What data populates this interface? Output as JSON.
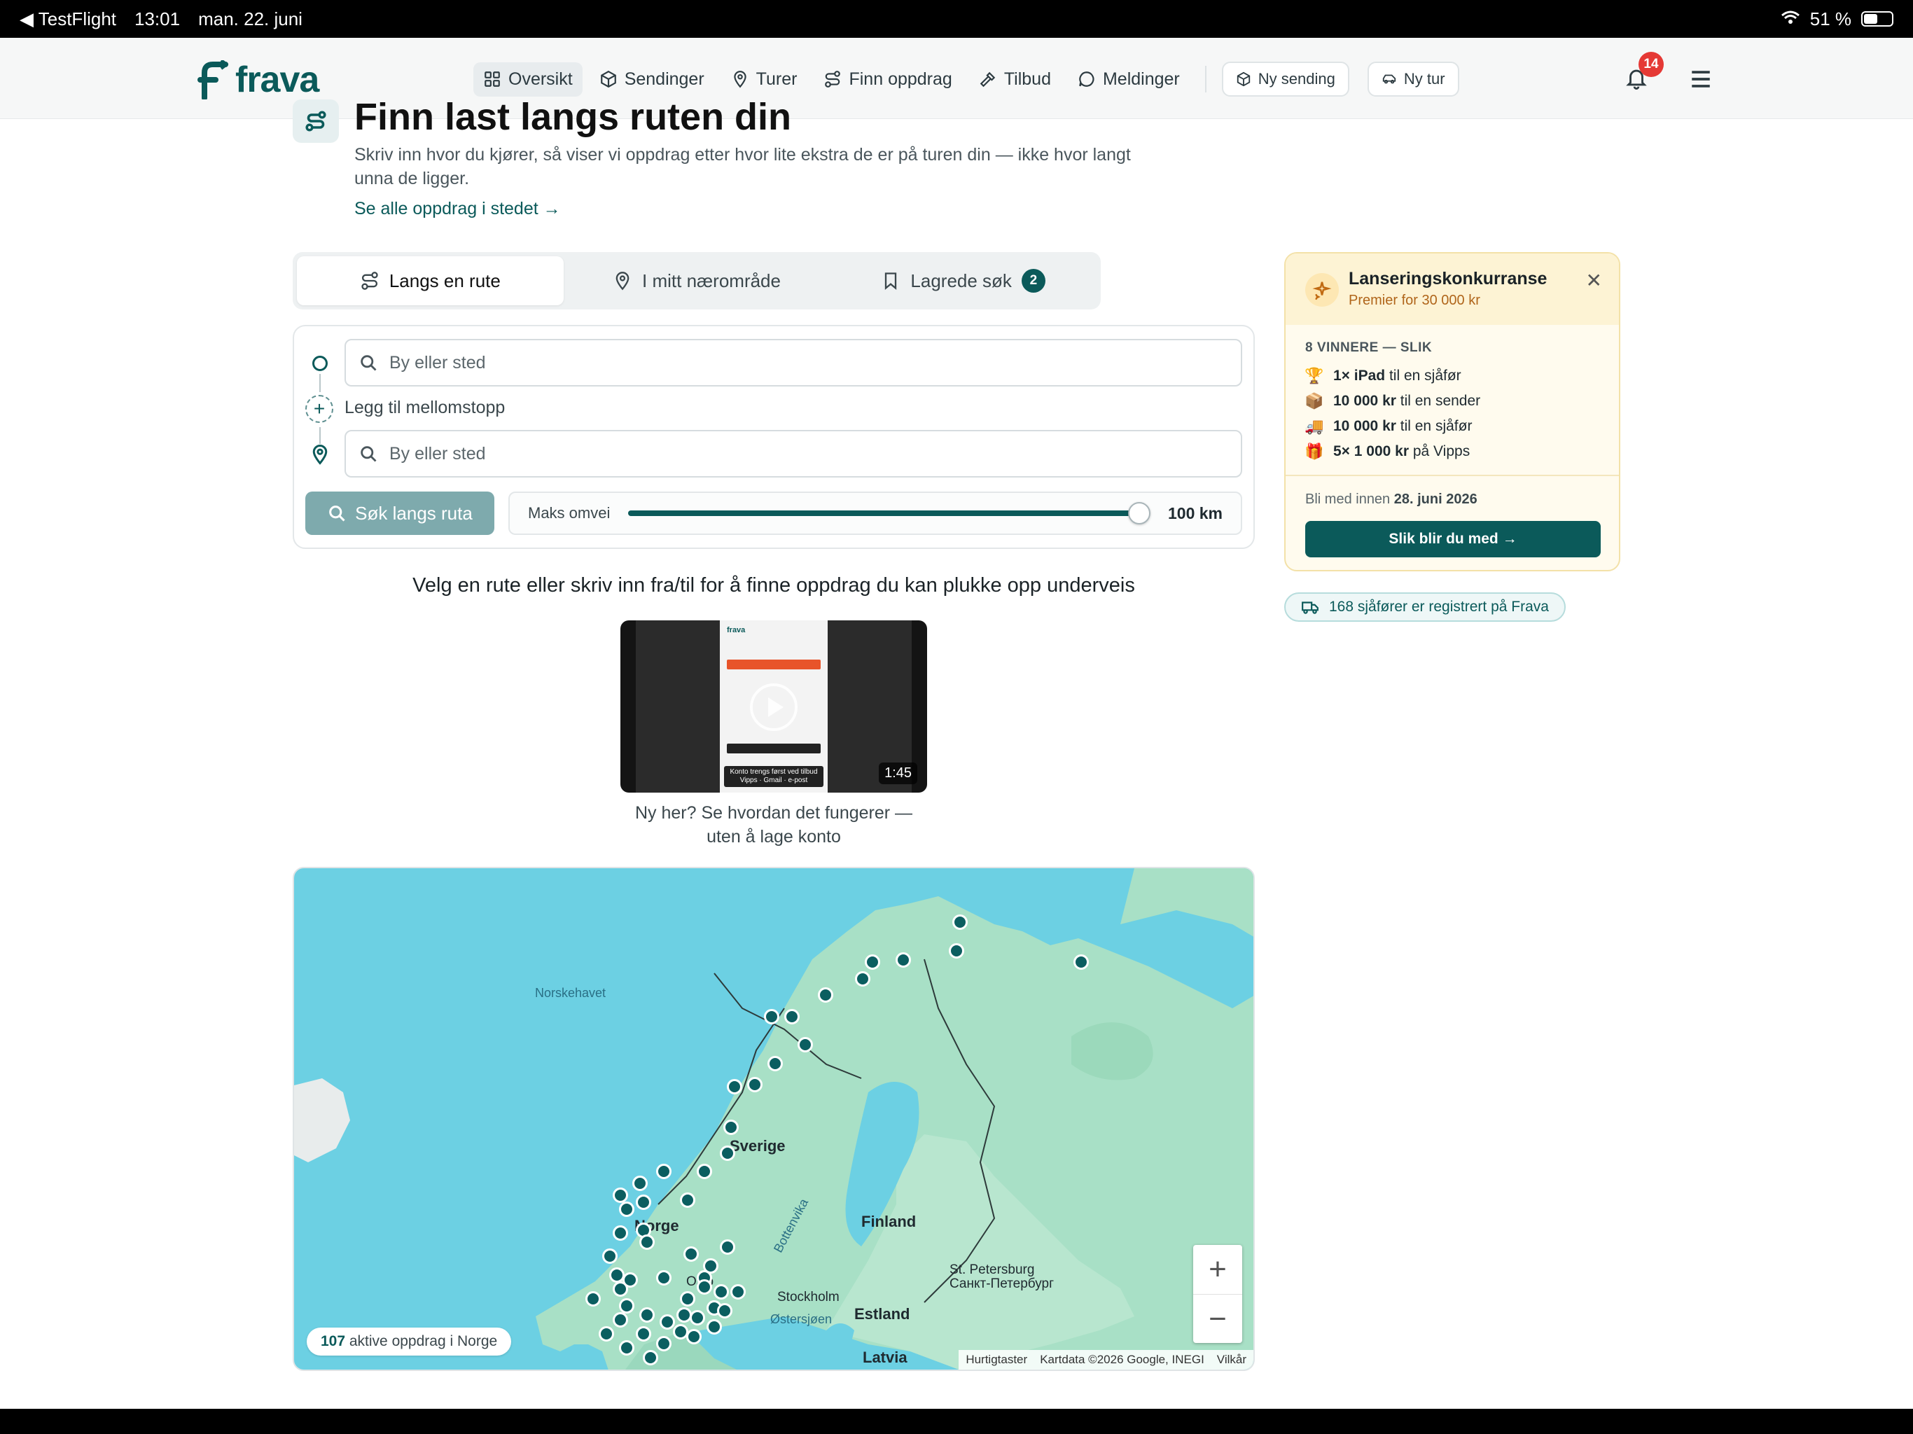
{
  "status_bar": {
    "back_app": "◀ TestFlight",
    "time": "13:01",
    "date": "man. 22. juni",
    "battery": "51 %",
    "battery_level": 0.51
  },
  "header": {
    "logo_text": "frava",
    "nav": [
      {
        "label": "Oversikt",
        "icon": "grid-icon",
        "active": true
      },
      {
        "label": "Sendinger",
        "icon": "box-icon"
      },
      {
        "label": "Turer",
        "icon": "pin-icon"
      },
      {
        "label": "Finn oppdrag",
        "icon": "route-icon"
      },
      {
        "label": "Tilbud",
        "icon": "hammer-icon"
      },
      {
        "label": "Meldinger",
        "icon": "chat-icon"
      }
    ],
    "new_shipment": "Ny sending",
    "new_trip": "Ny tur",
    "notifications_count": "14"
  },
  "intro": {
    "title": "Finn last langs ruten din",
    "description": "Skriv inn hvor du kjører, så viser vi oppdrag etter hvor lite ekstra de er på turen din — ikke hvor langt unna de ligger.",
    "link": "Se alle oppdrag i stedet →"
  },
  "tabs": [
    {
      "label": "Langs en rute",
      "active": true
    },
    {
      "label": "I mitt nærområde"
    },
    {
      "label": "Lagrede søk",
      "count": "2"
    }
  ],
  "search": {
    "from_placeholder": "By eller sted",
    "to_placeholder": "By eller sted",
    "add_stop": "Legg til mellomstopp",
    "button": "Søk langs ruta",
    "detour_label": "Maks omvei",
    "detour_value": "100 km",
    "detour_fraction": 1.0
  },
  "prompt": "Velg en rute eller skriv inn fra/til for å finne oppdrag du kan plukke opp underveis",
  "video": {
    "duration": "1:45",
    "inner_caption": "Konto trengs først ved tilbud Vipps · Gmail · e-post",
    "caption": "Ny her? Se hvordan det fungerer — uten å lage konto"
  },
  "map": {
    "labels": {
      "sea1": "Norskehavet",
      "sweden": "Sverige",
      "norway": "Norge",
      "finland": "Finland",
      "bothnia": "Bottenvika",
      "oslo": "Oslo",
      "stockholm": "Stockholm",
      "st_petersburg": "St. Petersburg\nСанкт-Петербург",
      "baltic": "Østersjøen",
      "estonia": "Estland",
      "latvia": "Latvia"
    },
    "active_count": "107",
    "active_text": " aktive oppdrag i Norge",
    "attribution": [
      "Hurtigtaster",
      "Kartdata ©2026 Google, INEGI",
      "Vilkår"
    ]
  },
  "promo": {
    "title": "Lanseringskonkurranse",
    "subtitle": "Premier for 30 000 kr",
    "winners_heading": "8 VINNERE — SLIK",
    "prizes": [
      {
        "icon": "🏆",
        "bold": "1× iPad",
        "text": " til en sjåfør"
      },
      {
        "icon": "📦",
        "bold": "10 000 kr",
        "text": " til en sender"
      },
      {
        "icon": "🚚",
        "bold": "10 000 kr",
        "text": " til en sjåfør"
      },
      {
        "icon": "🎁",
        "bold": "5× 1 000 kr",
        "text": " på Vipps"
      }
    ],
    "deadline_prefix": "Bli med innen ",
    "deadline_date": "28. juni 2026",
    "button": "Slik blir du med →"
  },
  "drivers": "168 sjåfører er registrert på Frava",
  "colors": {
    "brand": "#0b5a5a",
    "sea": "#6cd0e3",
    "land": "#a8e0c6",
    "badge_red": "#e53935"
  }
}
